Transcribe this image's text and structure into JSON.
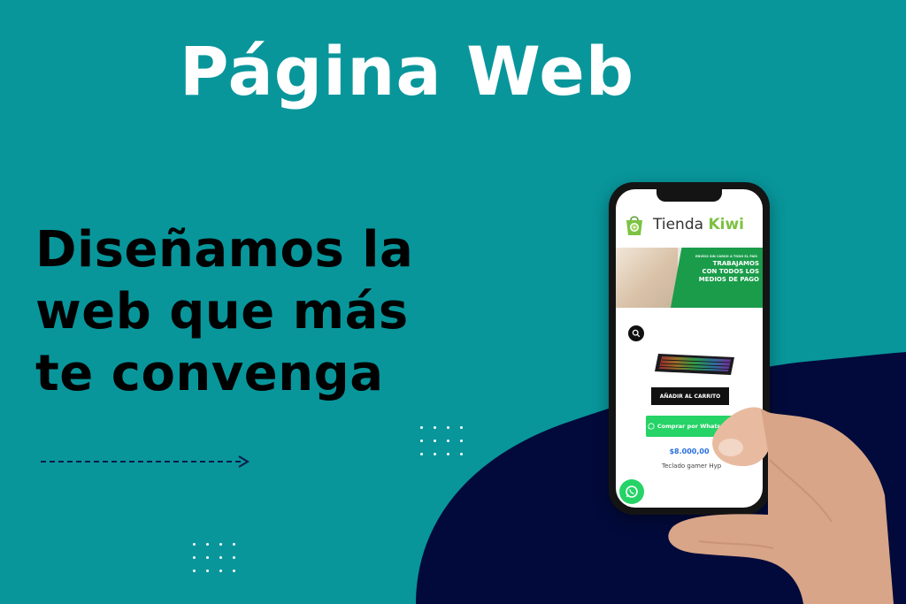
{
  "title": "Página Web",
  "headline": {
    "line1": "Diseñamos la",
    "line2": "web que más",
    "line3": "te convenga"
  },
  "colors": {
    "background": "#08969b",
    "blob": "#020a3b",
    "title": "#ffffff",
    "headline": "#000000",
    "brand_green": "#7cc243",
    "banner_green": "#1a9c4a",
    "whatsapp": "#25d366",
    "price": "#2a6fdb"
  },
  "phone": {
    "store": {
      "name_part1": "Tienda",
      "name_part2": "Kiwi",
      "logo_icon": "shopping-bag-icon"
    },
    "banner": {
      "small_text": "ENVÍOS SIN CARGO A TODO EL PAÍS",
      "line1": "TRABAJAMOS",
      "line2": "CON TODOS LOS",
      "line3": "MEDIOS DE PAGO"
    },
    "product": {
      "add_to_cart": "AÑADIR AL CARRITO",
      "buy_whatsapp": "Comprar por Whatsapp",
      "price": "$8.000,00",
      "name": "Teclado gamer Hyp"
    },
    "icons": {
      "search": "search-icon",
      "whatsapp_float": "whatsapp-icon"
    }
  },
  "decor": {
    "arrow_icon": "dashed-arrow-icon",
    "dots_icon": "dot-grid-icon"
  }
}
